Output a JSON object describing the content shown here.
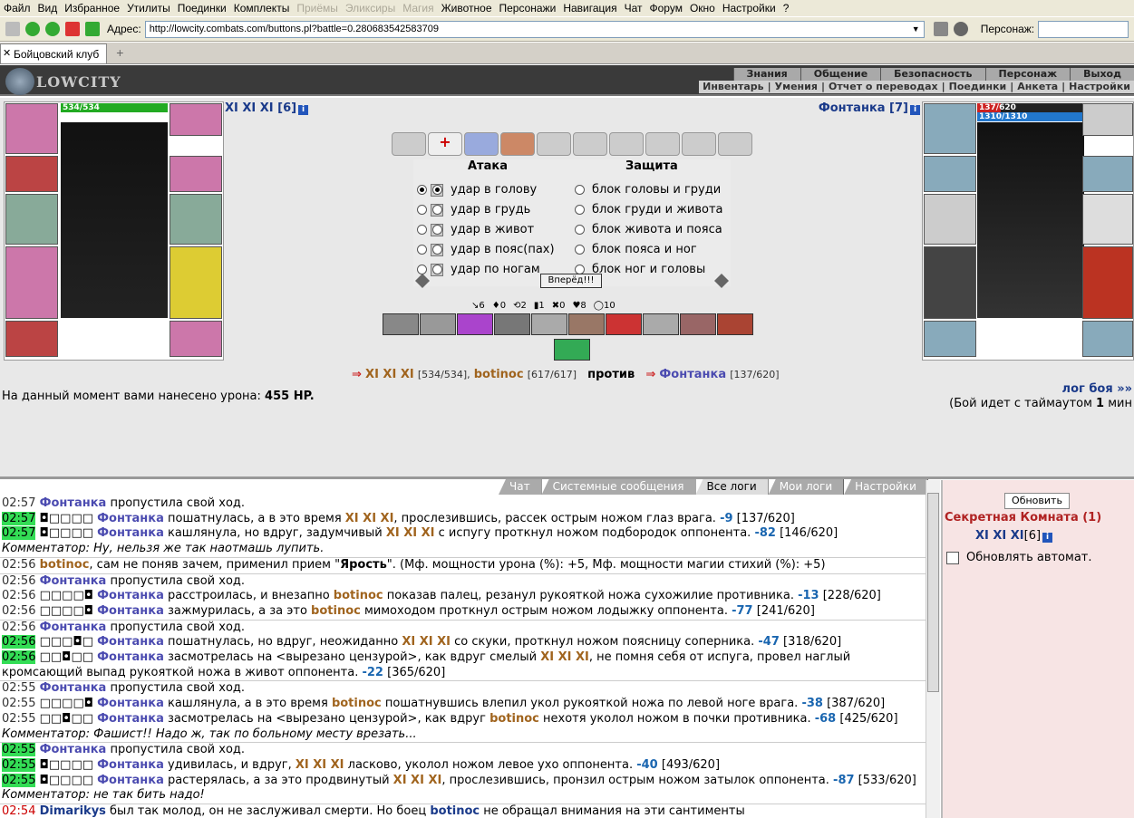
{
  "menu": [
    "Файл",
    "Вид",
    "Избранное",
    "Утилиты",
    "Поединки",
    "Комплекты",
    "Приёмы",
    "Эликсиры",
    "Магия",
    "Животное",
    "Персонажи",
    "Навигация",
    "Чат",
    "Форум",
    "Окно",
    "Настройки",
    "?"
  ],
  "menu_disabled": [
    6,
    7,
    8
  ],
  "toolbar": {
    "addr_label": "Адрес:",
    "url": "http://lowcity.combats.com/buttons.pl?battle=0.280683542583709",
    "pers_label": "Персонаж:"
  },
  "tab": {
    "title": "Бойцовский клуб",
    "plus": "+"
  },
  "game": {
    "logo": "LOWCITY",
    "topnav": [
      "Знания",
      "Общение",
      "Безопасность",
      "Персонаж",
      "Выход"
    ],
    "subnav": [
      "Инвентарь",
      "Умения",
      "Отчет о переводах",
      "Поединки",
      "Анкета",
      "Настройки"
    ]
  },
  "left": {
    "name": "XI XI XI [6]",
    "hp": "534/534"
  },
  "right": {
    "name": "Фонтанка [7]",
    "hp": "137/620",
    "mana": "1310/1310"
  },
  "attack": {
    "head": "Атака",
    "rows": [
      "удар в голову",
      "удар в грудь",
      "удар в живот",
      "удар в пояс(пах)",
      "удар по ногам"
    ]
  },
  "defense": {
    "head": "Защита",
    "rows": [
      "блок головы и груди",
      "блок груди и живота",
      "блок живота и пояса",
      "блок пояса и ног",
      "блок ног и головы"
    ]
  },
  "forward": "Вперёд!!!",
  "stats": [
    "↘6",
    "♦0",
    "⟲2",
    "▮1",
    "✖0",
    "♥8",
    "◯10"
  ],
  "vs": {
    "p1": "XI XI XI",
    "p1hp": "[534/534],",
    "p2": "botinoc",
    "p2hp": "[617/617]",
    "word": "против",
    "p3": "Фонтанка",
    "p3hp": "[137/620]"
  },
  "damage": {
    "label": "На данный момент вами нанесено урона:",
    "value": "455 HP."
  },
  "log_link": "лог боя »»",
  "timeout": {
    "pre": "(Бой идет с таймаутом",
    "val": "1",
    "post": "мин"
  },
  "chat_tabs": [
    "Чат",
    "Системные сообщения",
    "Все логи",
    "Мои логи",
    "Настройки"
  ],
  "chat_active": 2,
  "side": {
    "refresh": "Обновить",
    "room": "Секретная Комната (1)",
    "member": "XI XI XI",
    "member_lvl": "[6]",
    "auto": "Обновлять автомат."
  }
}
